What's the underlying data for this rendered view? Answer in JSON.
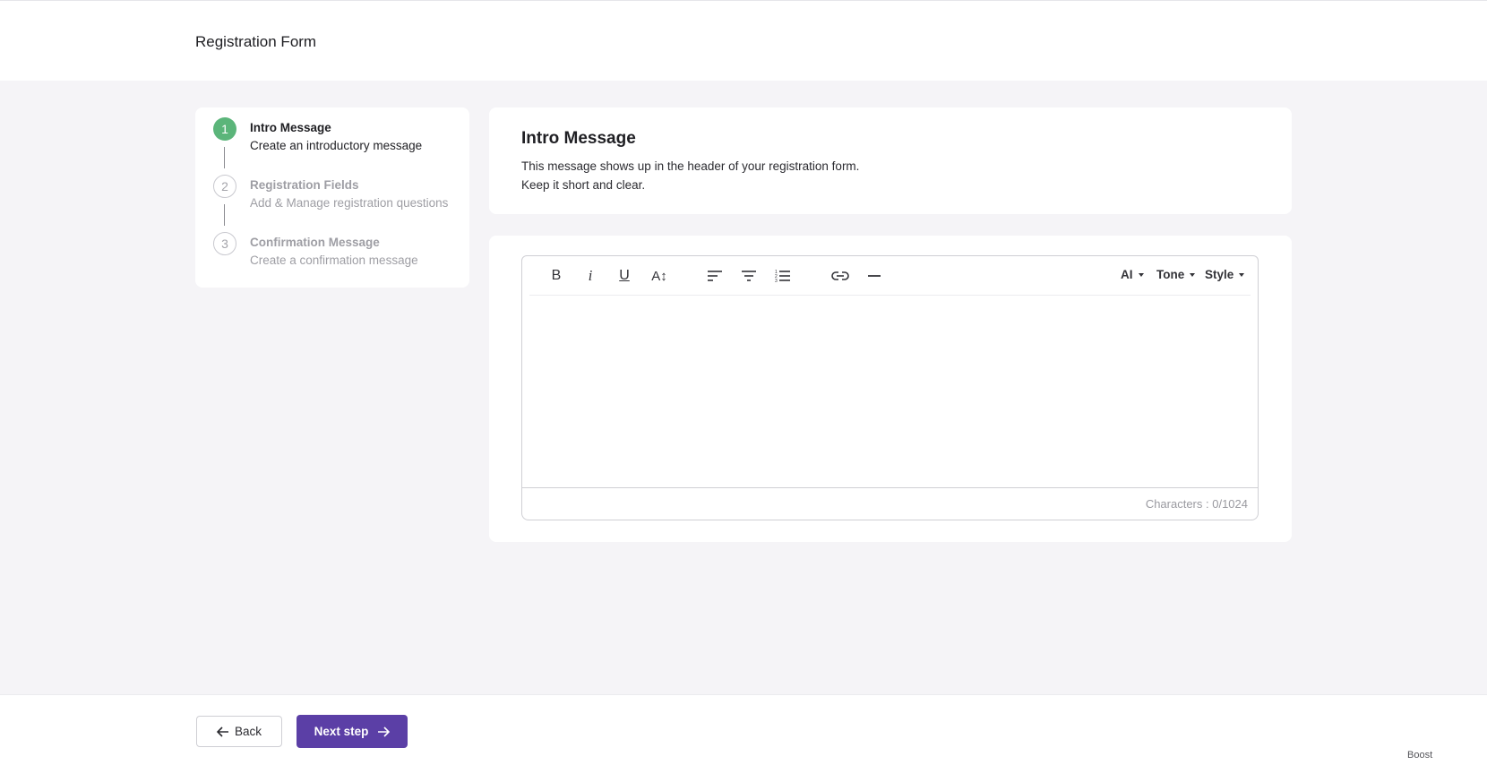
{
  "header": {
    "title": "Registration Form"
  },
  "stepper": {
    "steps": [
      {
        "number": "1",
        "title": "Intro Message",
        "subtitle": "Create an introductory message",
        "state": "active"
      },
      {
        "number": "2",
        "title": "Registration Fields",
        "subtitle": "Add & Manage registration questions",
        "state": "pending"
      },
      {
        "number": "3",
        "title": "Confirmation Message",
        "subtitle": "Create a confirmation message",
        "state": "pending"
      }
    ]
  },
  "intro": {
    "title": "Intro Message",
    "line1": "This message shows up in the header of your registration form.",
    "line2": "Keep it short and clear."
  },
  "editor": {
    "toolbar": {
      "bold": "B",
      "italic": "i",
      "underline": "U",
      "font_size": "A↕",
      "icons": [
        "bold-icon",
        "italic-icon",
        "underline-icon",
        "font-size-icon",
        "align-left-icon",
        "align-center-icon",
        "numbered-list-icon",
        "link-icon",
        "horizontal-rule-icon"
      ],
      "ai_label": "AI",
      "tone_label": "Tone",
      "style_label": "Style"
    },
    "content": "",
    "counter": "Characters : 0/1024"
  },
  "footer": {
    "back_label": "Back",
    "next_label": "Next step",
    "brand": "Boost"
  },
  "colors": {
    "accent": "#5b3fa6",
    "step_active": "#5bb57a",
    "page_bg": "#f5f4f7"
  }
}
